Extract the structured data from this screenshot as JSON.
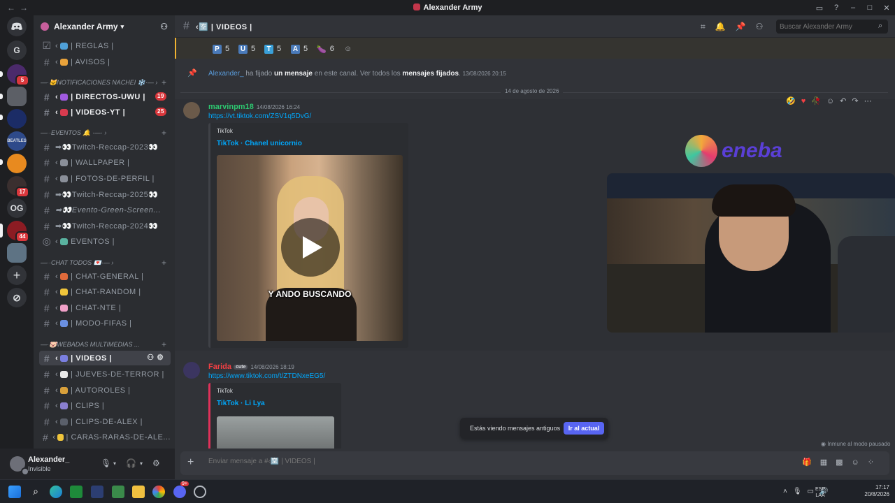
{
  "window": {
    "title": "Alexander Army",
    "controls": [
      "▭",
      "?",
      "–",
      "□",
      "✕"
    ]
  },
  "guilds": [
    {
      "name": "discord-home",
      "label": "",
      "color": "#313338"
    },
    {
      "name": "server-g",
      "label": "G",
      "color": "#313338"
    },
    {
      "name": "server-purple",
      "label": "",
      "color": "#4b2a6b",
      "badge": "5"
    },
    {
      "name": "server-gray",
      "label": "",
      "color": "#5c5f66"
    },
    {
      "name": "server-gold",
      "label": "",
      "color": "#1b2c66"
    },
    {
      "name": "server-beatles",
      "label": "",
      "color": "#2e4a8a"
    },
    {
      "name": "server-orange",
      "label": "",
      "color": "#e88a1f"
    },
    {
      "name": "server-dark",
      "label": "",
      "color": "#3a2f2f",
      "badge": "17"
    },
    {
      "name": "server-og",
      "label": "OG",
      "color": "#313338"
    },
    {
      "name": "server-red",
      "label": "",
      "color": "#8c1c23",
      "badge": "44"
    },
    {
      "name": "server-photo",
      "label": "",
      "color": "#5e7384"
    }
  ],
  "server": {
    "name": "Alexander Army"
  },
  "channels": [
    {
      "id": "reglas",
      "label": "| REGLAS |",
      "emoji": "#4fa0d8"
    },
    {
      "id": "avisos",
      "label": "| AVISOS |",
      "emoji": "#e8a23b"
    },
    {
      "id": "directos",
      "label": "| DIRECTOS-UWU |",
      "emoji": "#a05ae0",
      "badge": "19"
    },
    {
      "id": "videos-yt",
      "label": "| VIDEOS-YT |",
      "emoji": "#d83b4f",
      "badge": "25"
    },
    {
      "id": "twitch23",
      "label": "➡👀Twitch-Reccap-2023👀"
    },
    {
      "id": "wallpaper",
      "label": "| WALLPAPER |",
      "emoji": "#8a8f99"
    },
    {
      "id": "fotos",
      "label": "| FOTOS-DE-PERFIL |",
      "emoji": "#8a8f99"
    },
    {
      "id": "twitch25",
      "label": "➡👀Twitch-Reccap-2025👀"
    },
    {
      "id": "green",
      "label": "➡👀Evento-Green-Screen..."
    },
    {
      "id": "twitch24",
      "label": "➡👀Twitch-Reccap-2024👀"
    },
    {
      "id": "eventos",
      "label": "EVENTOS |"
    },
    {
      "id": "chat-general",
      "label": "| CHAT-GENERAL |",
      "emoji": "#e06a3b"
    },
    {
      "id": "chat-random",
      "label": "| CHAT-RANDOM |",
      "emoji": "#f0c53b"
    },
    {
      "id": "chat-nte",
      "label": "| CHAT-NTE |",
      "emoji": "#f0a0c8"
    },
    {
      "id": "modo-fifas",
      "label": "| MODO-FIFAS |",
      "emoji": "#6a8fe0"
    },
    {
      "id": "videos",
      "label": "| VIDEOS |",
      "emoji": "#7a7fe0"
    },
    {
      "id": "jueves",
      "label": "| JUEVES-DE-TERROR |",
      "emoji": "#e8e8e8"
    },
    {
      "id": "autoroles",
      "label": "| AUTOROLES |",
      "emoji": "#d8a03b"
    },
    {
      "id": "clips",
      "label": "| CLIPS |",
      "emoji": "#8a7fd0"
    },
    {
      "id": "clips-alex",
      "label": "| CLIPS-DE-ALEX |",
      "emoji": "#5a5f6a"
    },
    {
      "id": "caras",
      "label": "| CARAS-RARAS-DE-ALE...",
      "emoji": "#f0c53b"
    }
  ],
  "categories": {
    "notificaciones": "NOTIFICACIONES NACHEI",
    "eventos": "EVENTOS 🔔",
    "chat_todos": "CHAT TODOS",
    "webadas": "WEBADAS MULTIMEDIAS ..."
  },
  "user": {
    "name": "Alexander_",
    "status": "Invisible"
  },
  "chat": {
    "channel_name": "| VIDEOS |",
    "search_placeholder": "Buscar Alexander Army",
    "reactions": [
      {
        "letter": "P",
        "count": "5"
      },
      {
        "letter": "U",
        "count": "5"
      },
      {
        "letter": "T",
        "count": "5"
      },
      {
        "letter": "A",
        "count": "5"
      },
      {
        "letter": "🍆",
        "count": "6"
      }
    ],
    "system": {
      "who": "Alexander_",
      "t1": " ha fijado ",
      "bold1": "un mensaje",
      "t2": " en este canal. Ver todos los ",
      "bold2": "mensajes fijados",
      "t3": ".",
      "time": "13/08/2026 20:15"
    },
    "date_divider": "14 de agosto de 2026",
    "messages": [
      {
        "author": "marvinpm18",
        "author_color": "#2dc770",
        "time": "14/08/2026 16:24",
        "link": "https://vt.tiktok.com/ZSV1q5DvG/",
        "embed_provider": "TikTok",
        "embed_title": "TikTok · Chanel unicornio",
        "caption": "Y ANDO BUSCANDO"
      },
      {
        "author": "Farida",
        "author_color": "#f23f43",
        "tag": "cute",
        "time": "14/08/2026 18:19",
        "link": "https://www.tiktok.com/t/ZTDNxeEG5/",
        "embed_provider": "TikTok",
        "embed_title": "TikTok · Li Lya"
      }
    ],
    "old_messages_notice": "Estás viendo mensajes antiguos",
    "jump_button": "Ir al actual",
    "slowmode": "Inmune al modo pausado",
    "composer_placeholder": "Enviar mensaje a #‹🈳 | VIDEOS |"
  },
  "overlay": {
    "brand": "eneba"
  },
  "taskbar": {
    "lang1": "ESP",
    "lang2": "LAA",
    "time": "17:17",
    "date": "20/8/2026",
    "discord_badge": "9+"
  }
}
